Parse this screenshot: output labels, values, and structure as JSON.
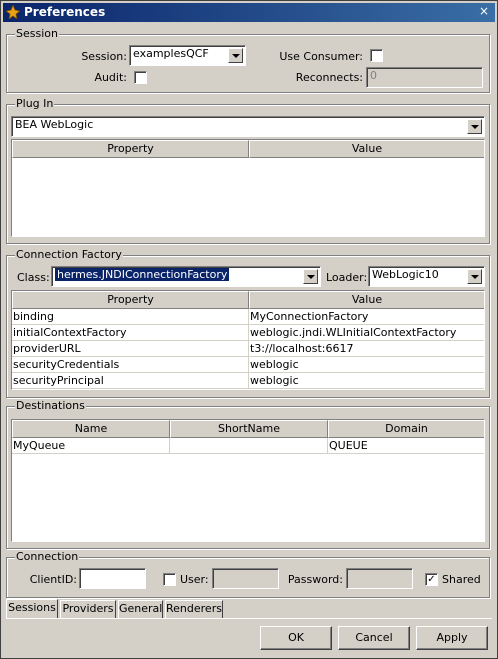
{
  "window": {
    "title": "Preferences",
    "close": "×"
  },
  "session": {
    "group_label": "Session",
    "session_label": "Session:",
    "session_value": "examplesQCF",
    "use_consumer_label": "Use Consumer:",
    "use_consumer_checked": false,
    "audit_label": "Audit:",
    "audit_checked": false,
    "reconnects_label": "Reconnects:",
    "reconnects_value": "0"
  },
  "plugin": {
    "group_label": "Plug In",
    "selected": "BEA WebLogic",
    "columns": [
      "Property",
      "Value"
    ],
    "rows": []
  },
  "connection_factory": {
    "group_label": "Connection Factory",
    "class_label": "Class:",
    "class_value": "hermes.JNDIConnectionFactory",
    "loader_label": "Loader:",
    "loader_value": "WebLogic10",
    "columns": [
      "Property",
      "Value"
    ],
    "rows": [
      [
        "binding",
        "MyConnectionFactory"
      ],
      [
        "initialContextFactory",
        "weblogic.jndi.WLInitialContextFactory"
      ],
      [
        "providerURL",
        "t3://localhost:6617"
      ],
      [
        "securityCredentials",
        "weblogic"
      ],
      [
        "securityPrincipal",
        "weblogic"
      ]
    ]
  },
  "destinations": {
    "group_label": "Destinations",
    "columns": [
      "Name",
      "ShortName",
      "Domain"
    ],
    "rows": [
      [
        "MyQueue",
        "",
        "QUEUE"
      ]
    ]
  },
  "connection": {
    "group_label": "Connection",
    "clientid_label": "ClientID:",
    "clientid_value": "",
    "user_label": "User:",
    "user_checked": false,
    "user_value": "",
    "password_label": "Password:",
    "password_value": "",
    "shared_label": "Shared",
    "shared_checked": true
  },
  "tabs": [
    "Sessions",
    "Providers",
    "General",
    "Renderers"
  ],
  "buttons": {
    "ok": "OK",
    "cancel": "Cancel",
    "apply": "Apply"
  }
}
